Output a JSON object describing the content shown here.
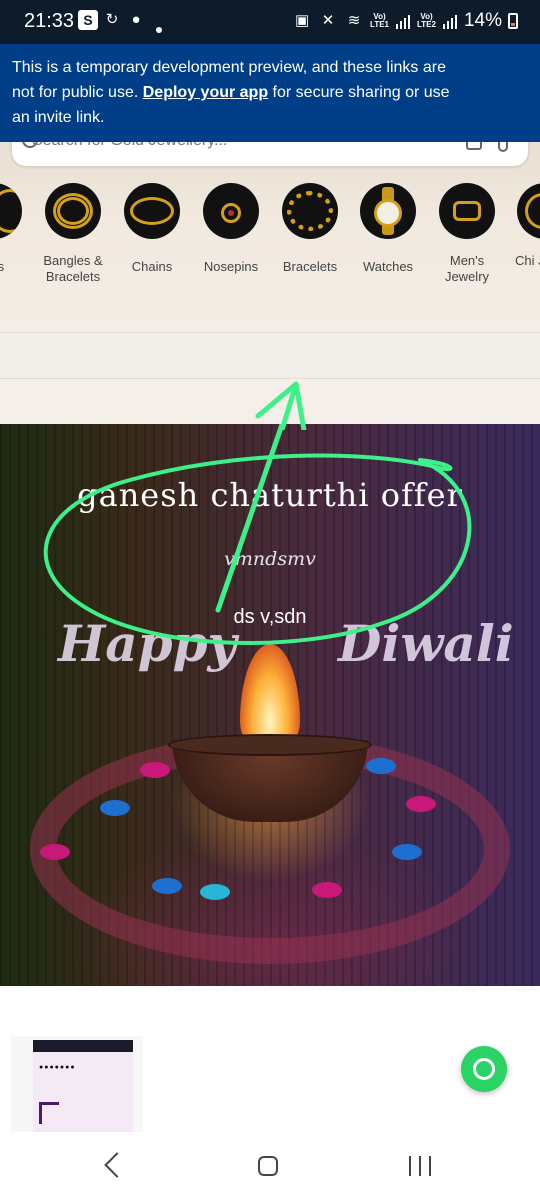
{
  "status_bar": {
    "time": "21:33",
    "battery": "14%",
    "sim1_label": "Vo)\nLTE1",
    "sim2_label": "Vo)\nLTE2"
  },
  "dev_banner": {
    "text_before": "This is a temporary development preview, and these links are not for public use. ",
    "link": "Deploy your app",
    "text_after": " for secure sharing or use an invite link."
  },
  "search": {
    "placeholder": "Search for Gold Jewellery..."
  },
  "categories": [
    {
      "label": "ces"
    },
    {
      "label": "Bangles & Bracelets"
    },
    {
      "label": "Chains"
    },
    {
      "label": "Nosepins"
    },
    {
      "label": "Bracelets"
    },
    {
      "label": "Watches"
    },
    {
      "label": "Men's Jewelry"
    },
    {
      "label": "Chi Je"
    }
  ],
  "promo": {
    "title": "ganesh chaturthi offer",
    "subtitle": "vmndsmv",
    "small_text": "ds v,sdn",
    "art_word_1": "Happy",
    "art_word_2": "Diwali"
  },
  "colors": {
    "dev_banner_bg": "#003f87",
    "annotation_green": "#3df08a",
    "whatsapp_green": "#2bd366"
  }
}
